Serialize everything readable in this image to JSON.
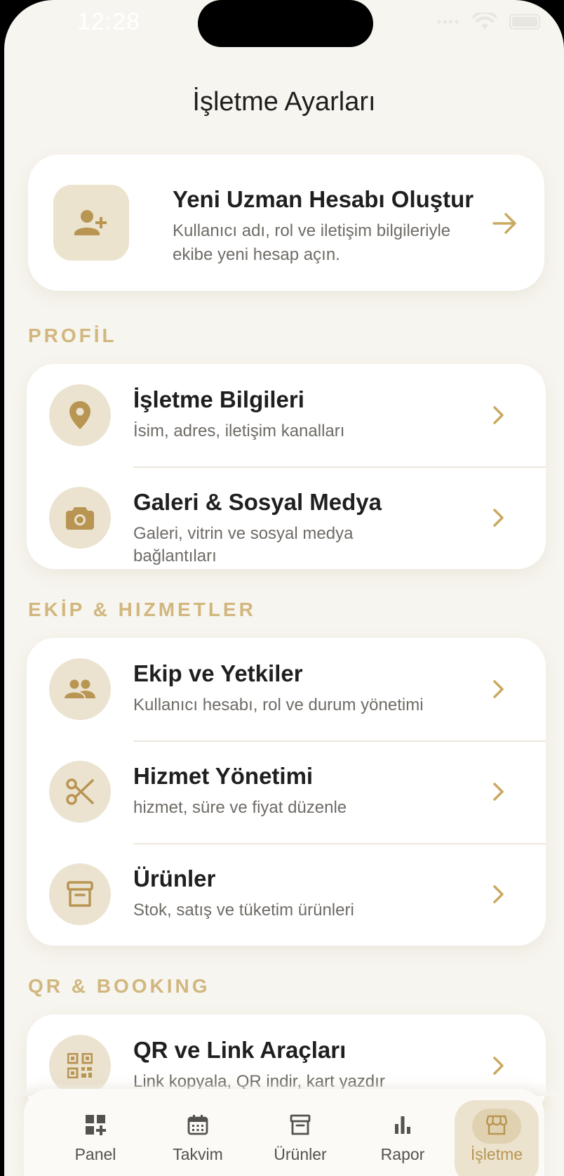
{
  "status_bar": {
    "time": "12:28"
  },
  "page_title": "İşletme Ayarları",
  "hero": {
    "title": "Yeni Uzman Hesabı Oluştur",
    "subtitle": "Kullanıcı adı, rol ve iletişim bilgileriyle ekibe yeni hesap açın.",
    "icon": "person-add-icon"
  },
  "sections": [
    {
      "label": "PROFİL",
      "items": [
        {
          "title": "İşletme Bilgileri",
          "subtitle": "İsim, adres, iletişim kanalları",
          "icon": "location-pin-icon"
        },
        {
          "title": "Galeri & Sosyal Medya",
          "subtitle": "Galeri, vitrin ve sosyal medya bağlantıları",
          "icon": "camera-icon"
        }
      ]
    },
    {
      "label": "EKİP & HIZMETLER",
      "items": [
        {
          "title": "Ekip ve Yetkiler",
          "subtitle": "Kullanıcı hesabı, rol ve durum yönetimi",
          "icon": "people-icon"
        },
        {
          "title": "Hizmet Yönetimi",
          "subtitle": "hizmet, süre ve fiyat düzenle",
          "icon": "scissors-icon"
        },
        {
          "title": "Ürünler",
          "subtitle": "Stok, satış ve tüketim ürünleri",
          "icon": "archive-box-icon"
        }
      ]
    },
    {
      "label": "QR & BOOKING",
      "items": [
        {
          "title": "QR ve Link Araçları",
          "subtitle": "Link kopyala, QR indir, kart yazdır",
          "icon": "qr-code-icon"
        }
      ]
    }
  ],
  "tabbar": {
    "tabs": [
      {
        "label": "Panel",
        "icon": "dashboard-add-icon"
      },
      {
        "label": "Takvim",
        "icon": "calendar-icon"
      },
      {
        "label": "Ürünler",
        "icon": "archive-box-icon"
      },
      {
        "label": "Rapor",
        "icon": "bar-chart-icon"
      },
      {
        "label": "İşletme",
        "icon": "storefront-icon"
      }
    ],
    "active_tab": "İşletme"
  },
  "colors": {
    "accent": "#c9a961",
    "accent_light": "#ece3cf",
    "background": "#f7f5ef",
    "card": "#ffffff"
  }
}
